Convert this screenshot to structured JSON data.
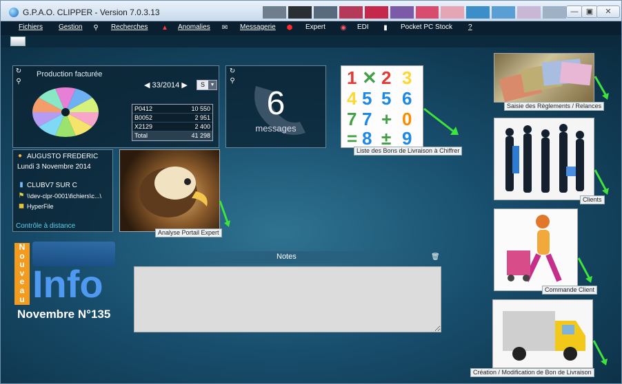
{
  "window": {
    "title": "G.P.A.O. CLIPPER - Version 7.0.3.13",
    "minimize_label": "—",
    "maximize_label": "▣",
    "close_label": "✕"
  },
  "menu": {
    "items": [
      "Fichiers",
      "Gestion",
      "Recherches",
      "Anomalies",
      "Messagerie",
      "Expert",
      "EDI",
      "Pocket PC Stock",
      "?"
    ]
  },
  "production": {
    "title": "Production facturée",
    "period": "33/2014",
    "period_prev": "◀",
    "period_next": "▶",
    "unit": "S",
    "rows": [
      {
        "code": "P0412",
        "value": "10 550"
      },
      {
        "code": "B0052",
        "value": "2 951"
      },
      {
        "code": "X2129",
        "value": "2 400"
      }
    ],
    "total_label": "Total",
    "total_value": "41 298",
    "pie_colors": [
      "#f7a6c9",
      "#f5e46b",
      "#9be36c",
      "#7fd8f5",
      "#b59cf2",
      "#f59d6a",
      "#88e8c6",
      "#e87fd7",
      "#6fb0f2",
      "#d5f27a"
    ]
  },
  "messages": {
    "count": "6",
    "label": "messages"
  },
  "user": {
    "name": "AUGUSTO FREDERIC",
    "date": "Lundi 3 Novembre 2014",
    "db": "CLUBV7 SUR C",
    "path": "\\\\dev-clpr-0001\\fichiers\\c...\\",
    "engine": "HyperFile",
    "remote_link": "Contrôle à distance"
  },
  "tiles": {
    "bons_livraison": "Liste des Bons de Livraison à Chiffrer",
    "reglements": "Saisie des Règlements / Relances",
    "clients": "Clients",
    "commande": "Commande Client",
    "creation_bl": "Création / Modification de Bon de Livraison",
    "portail": "Analyse Portail Expert"
  },
  "clipinfo": {
    "nouveau": [
      "N",
      "o",
      "u",
      "v",
      "e",
      "a",
      "u"
    ],
    "brand": "Info",
    "issue": "Novembre N°135"
  },
  "notes": {
    "title": "Notes"
  }
}
